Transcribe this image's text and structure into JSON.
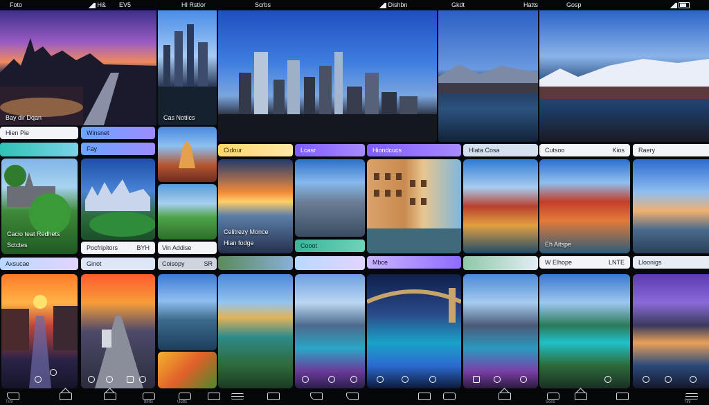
{
  "status_bar": {
    "left_label": "Foto",
    "mid_label_1": "H&",
    "mid_label_2": "EV5",
    "mid_label_3": "HI Rstlor",
    "mid_label_4": "Scrbs",
    "mid_label_5": "Dishbn",
    "mid_label_6": "Gkdt",
    "mid_label_7": "Hatts",
    "mid_label_8": "Gosp"
  },
  "tiles": {
    "t1_label": "Bay dir Dqan",
    "t2_label": "Cas Notiics",
    "t3_label": "Cacio teat Redhets",
    "t3_sub": "Sctctes",
    "t4_label": "Celitrezy Monce",
    "t4_sub": "Hian fodge",
    "t5_label": "Eh Aitspe"
  },
  "pills": {
    "p1": "Hien Pie",
    "p2": "Winsnet",
    "p3": "Fay",
    "p4": "Axsucae",
    "p5": "Pocfripitors",
    "p5_right": "BYH",
    "p6": "Ginot",
    "p7": "Vin Addise",
    "p8": "Coisopy",
    "p8_right": "SR",
    "p9": "Cidour",
    "p10": "Lcasr",
    "p11": "Hiondcucs",
    "p12": "Hlata Cosa",
    "p13": "Cutsoo",
    "p13_right": "Kios",
    "p14": "Raery",
    "p15": "Cooot",
    "p16": "Mbce",
    "p17": "W Elhope",
    "p17_right": "LNTE",
    "p18": "Lloonigs"
  },
  "bottom_nav": {
    "l1": "Trnl",
    "l2": "Itmts",
    "l3": "Uotts",
    "l4": "Sons",
    "l5": "Tinl"
  }
}
